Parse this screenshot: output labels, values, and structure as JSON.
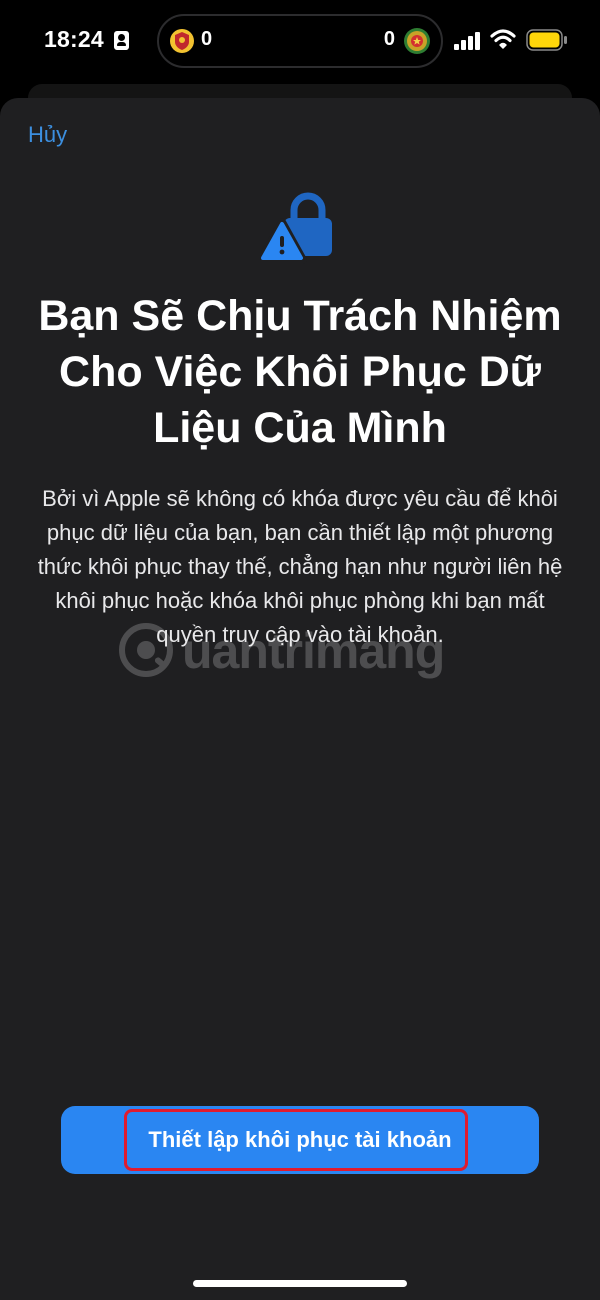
{
  "status_bar": {
    "time": "18:24",
    "island_left_count": "0",
    "island_right_count": "0",
    "icons": [
      "contact-card-icon",
      "badge-icon",
      "medal-icon",
      "cellular-signal-icon",
      "wifi-icon",
      "battery-icon"
    ],
    "battery_color": "#ffd60a"
  },
  "sheet": {
    "cancel_label": "Hủy",
    "hero_icon": "lock-warning-icon",
    "title": "Bạn Sẽ Chịu Trách Nhiệm Cho Việc Khôi Phục Dữ Liệu Của Mình",
    "description": "Bởi vì Apple sẽ không có khóa được yêu cầu để khôi phục dữ liệu của bạn, bạn cần thiết lập một phương thức khôi phục thay thế, chẳng hạn như người liên hệ khôi phục hoặc khóa khôi phục phòng khi bạn mất quyền truy cập vào tài khoản.",
    "primary_button_label": "Thiết lập khôi phục tài khoản"
  },
  "watermark": {
    "text": "uantrimang"
  },
  "colors": {
    "accent": "#2a86f2",
    "link": "#3c8fe0",
    "highlight": "#e01b2f",
    "sheet_background": "#1f1f21"
  }
}
